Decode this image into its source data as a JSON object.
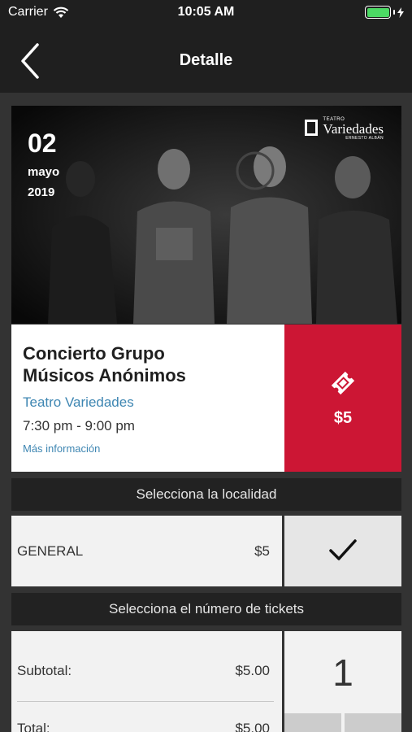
{
  "status_bar": {
    "carrier": "Carrier",
    "time": "10:05 AM"
  },
  "nav": {
    "title": "Detalle"
  },
  "hero": {
    "date_day": "02",
    "date_month": "mayo",
    "date_year": "2019",
    "logo_small": "TEATRO",
    "logo_name": "Variedades",
    "logo_sub": "ERNESTO ALBÁN"
  },
  "event": {
    "title": "Concierto Grupo Músicos Anónimos",
    "venue": "Teatro Variedades",
    "time": "7:30 pm - 9:00 pm",
    "more_info": "Más información",
    "price": "$5"
  },
  "locality_section": {
    "header": "Selecciona la localidad",
    "items": [
      {
        "name": "GENERAL",
        "price": "$5",
        "selected": true
      }
    ]
  },
  "tickets_section": {
    "header": "Selecciona el número de tickets",
    "subtotal_label": "Subtotal:",
    "subtotal_value": "$5.00",
    "total_label": "Total:",
    "total_value": "$5.00",
    "quantity": "1"
  },
  "colors": {
    "background": "#333333",
    "bar": "#1f1f1f",
    "accent_red": "#cc1634",
    "link_blue": "#3e86b2",
    "battery_green": "#4cd964"
  },
  "icons": {
    "wifi": "wifi-icon",
    "battery": "battery-icon",
    "charging": "charging-bolt-icon",
    "back": "chevron-left-icon",
    "ticket": "ticket-icon",
    "check": "checkmark-icon"
  }
}
